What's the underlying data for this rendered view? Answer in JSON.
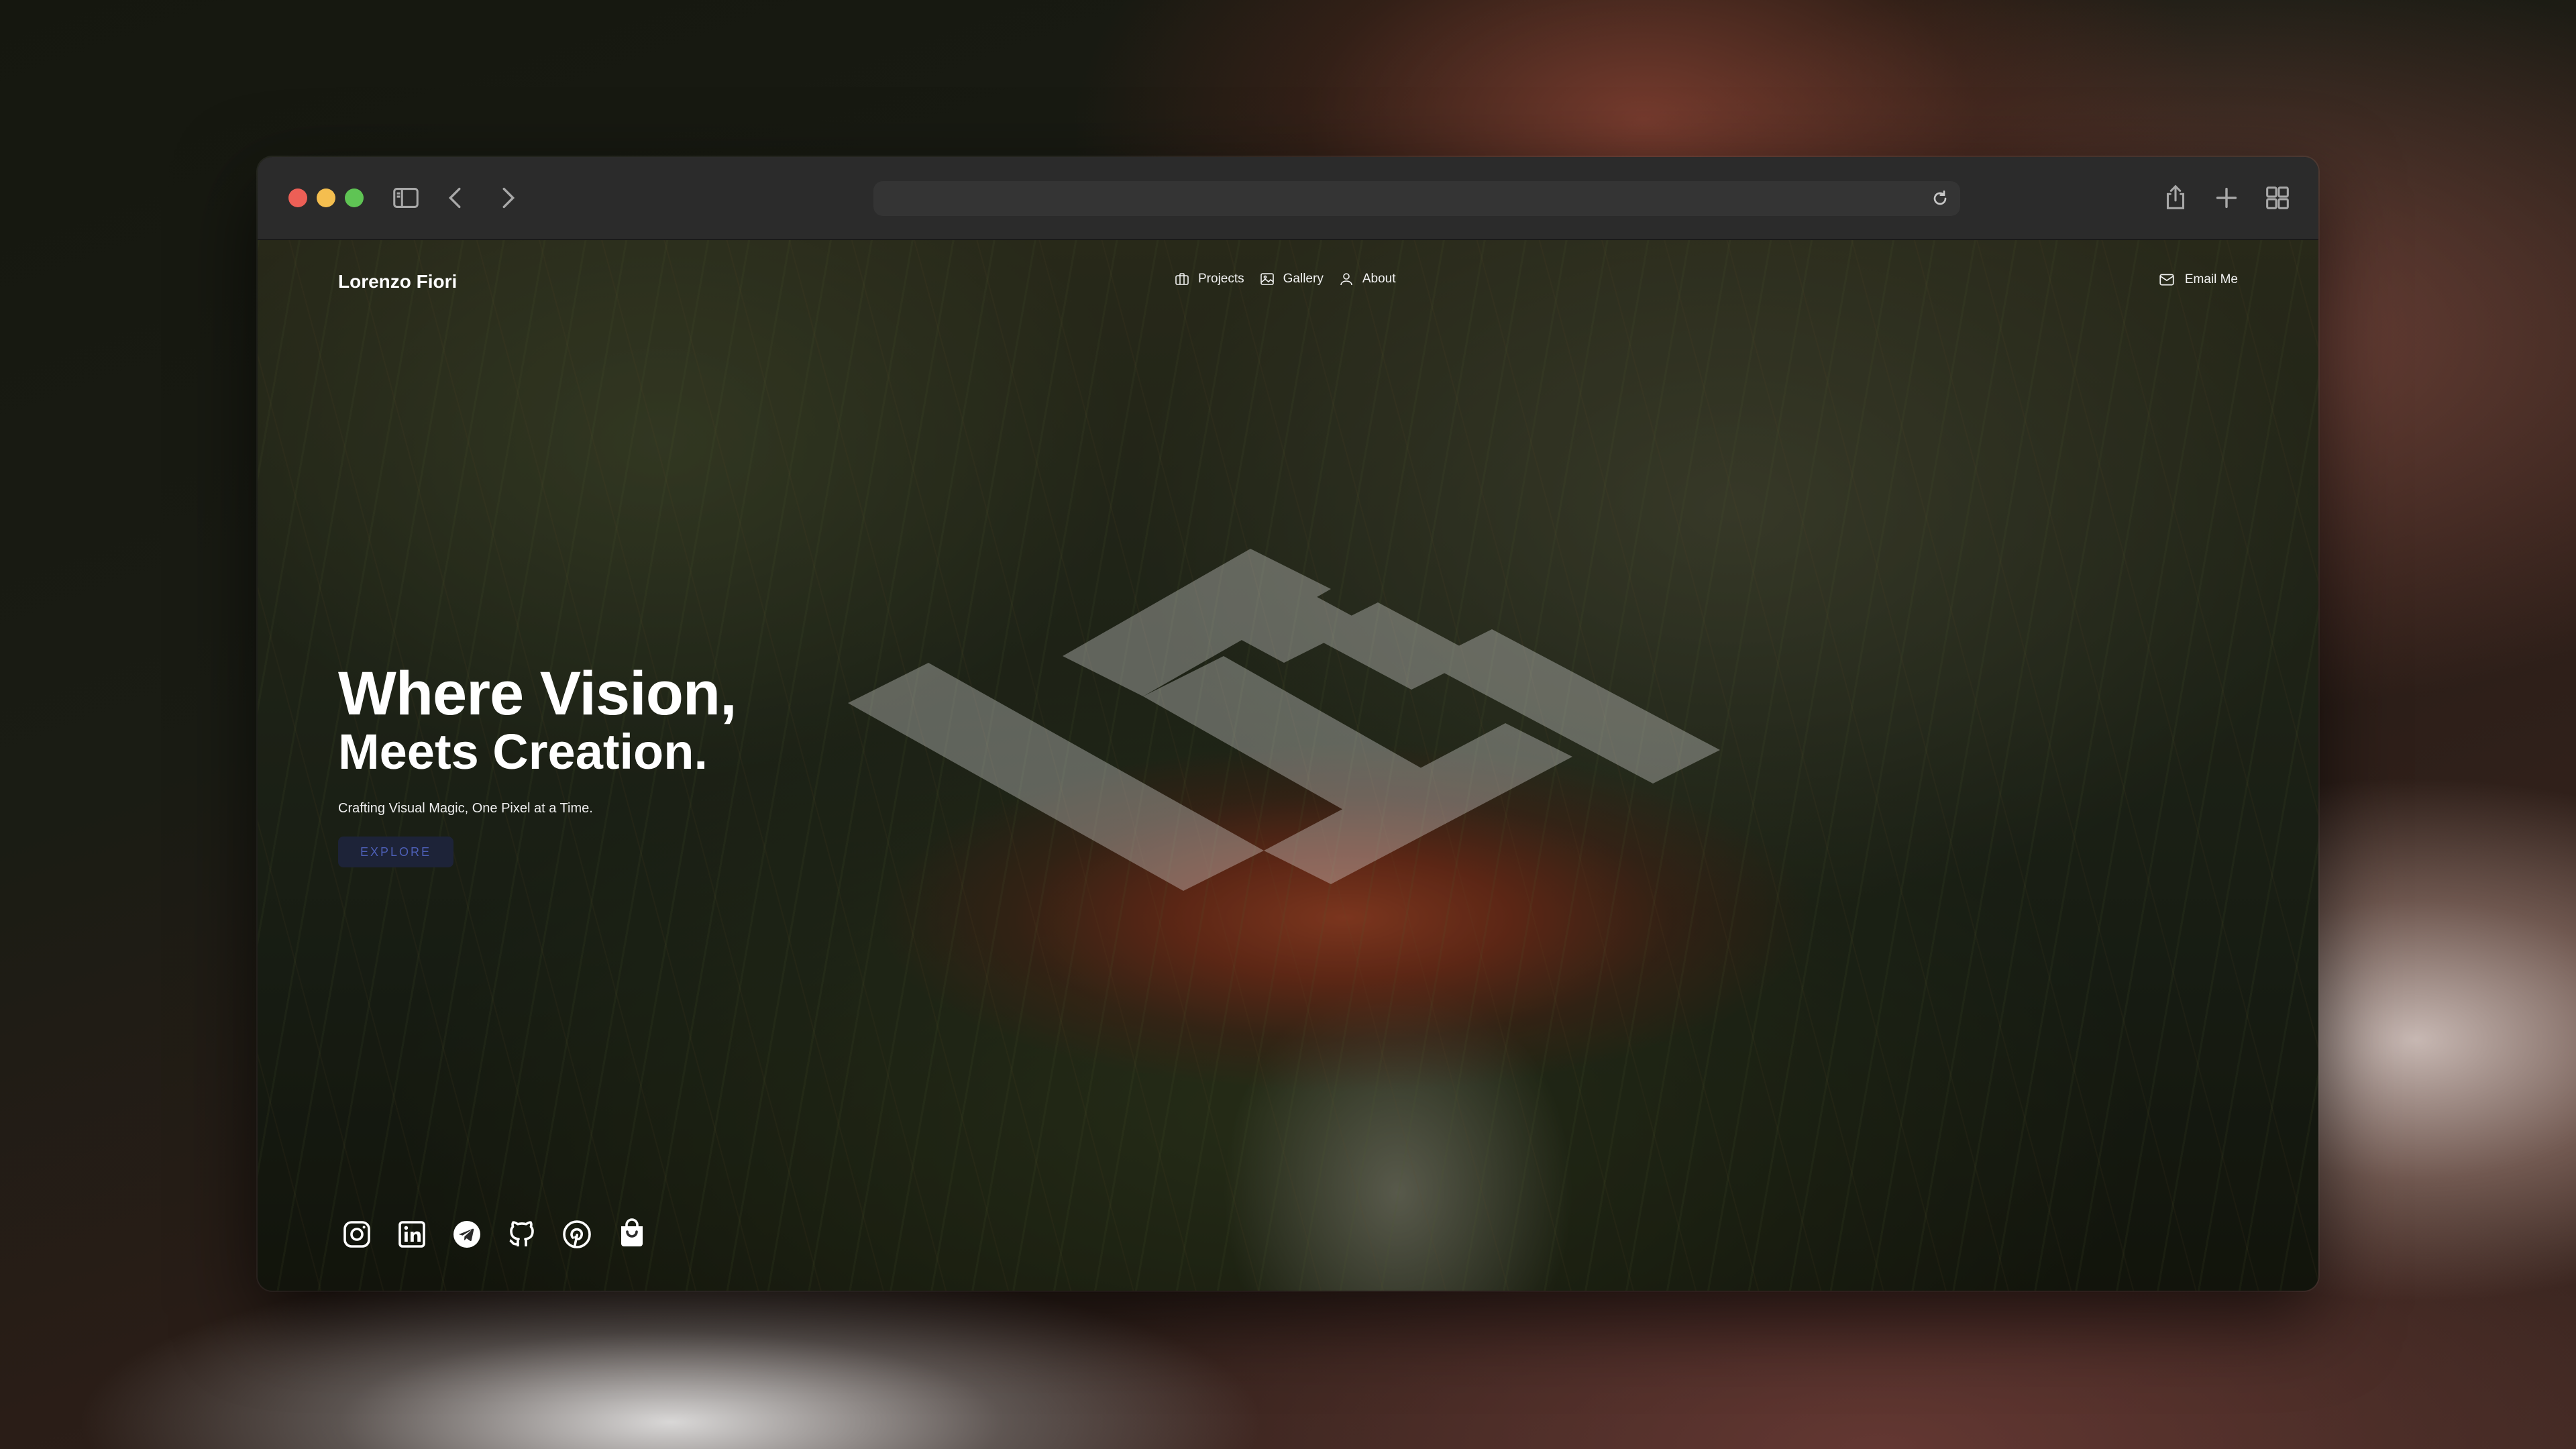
{
  "site": {
    "brand": "Lorenzo Fiori",
    "nav": [
      {
        "label": "Projects",
        "icon": "briefcase-icon"
      },
      {
        "label": "Gallery",
        "icon": "image-icon"
      },
      {
        "label": "About",
        "icon": "user-icon"
      }
    ],
    "email_label": "Email Me"
  },
  "hero": {
    "line1": "Where Vision,",
    "line2": "Meets Creation.",
    "subtitle": "Crafting Visual Magic, One Pixel at a Time.",
    "cta": "EXPLORE"
  },
  "socials": [
    "instagram-icon",
    "linkedin-icon",
    "telegram-icon",
    "github-icon",
    "pinterest-icon",
    "shopping-bag-icon"
  ],
  "colors": {
    "cta_bg": "#1d2338",
    "cta_text": "#4d5fb6",
    "traffic_close": "#ed5f56",
    "traffic_minimize": "#f4be4f",
    "traffic_maximize": "#5fc454"
  }
}
